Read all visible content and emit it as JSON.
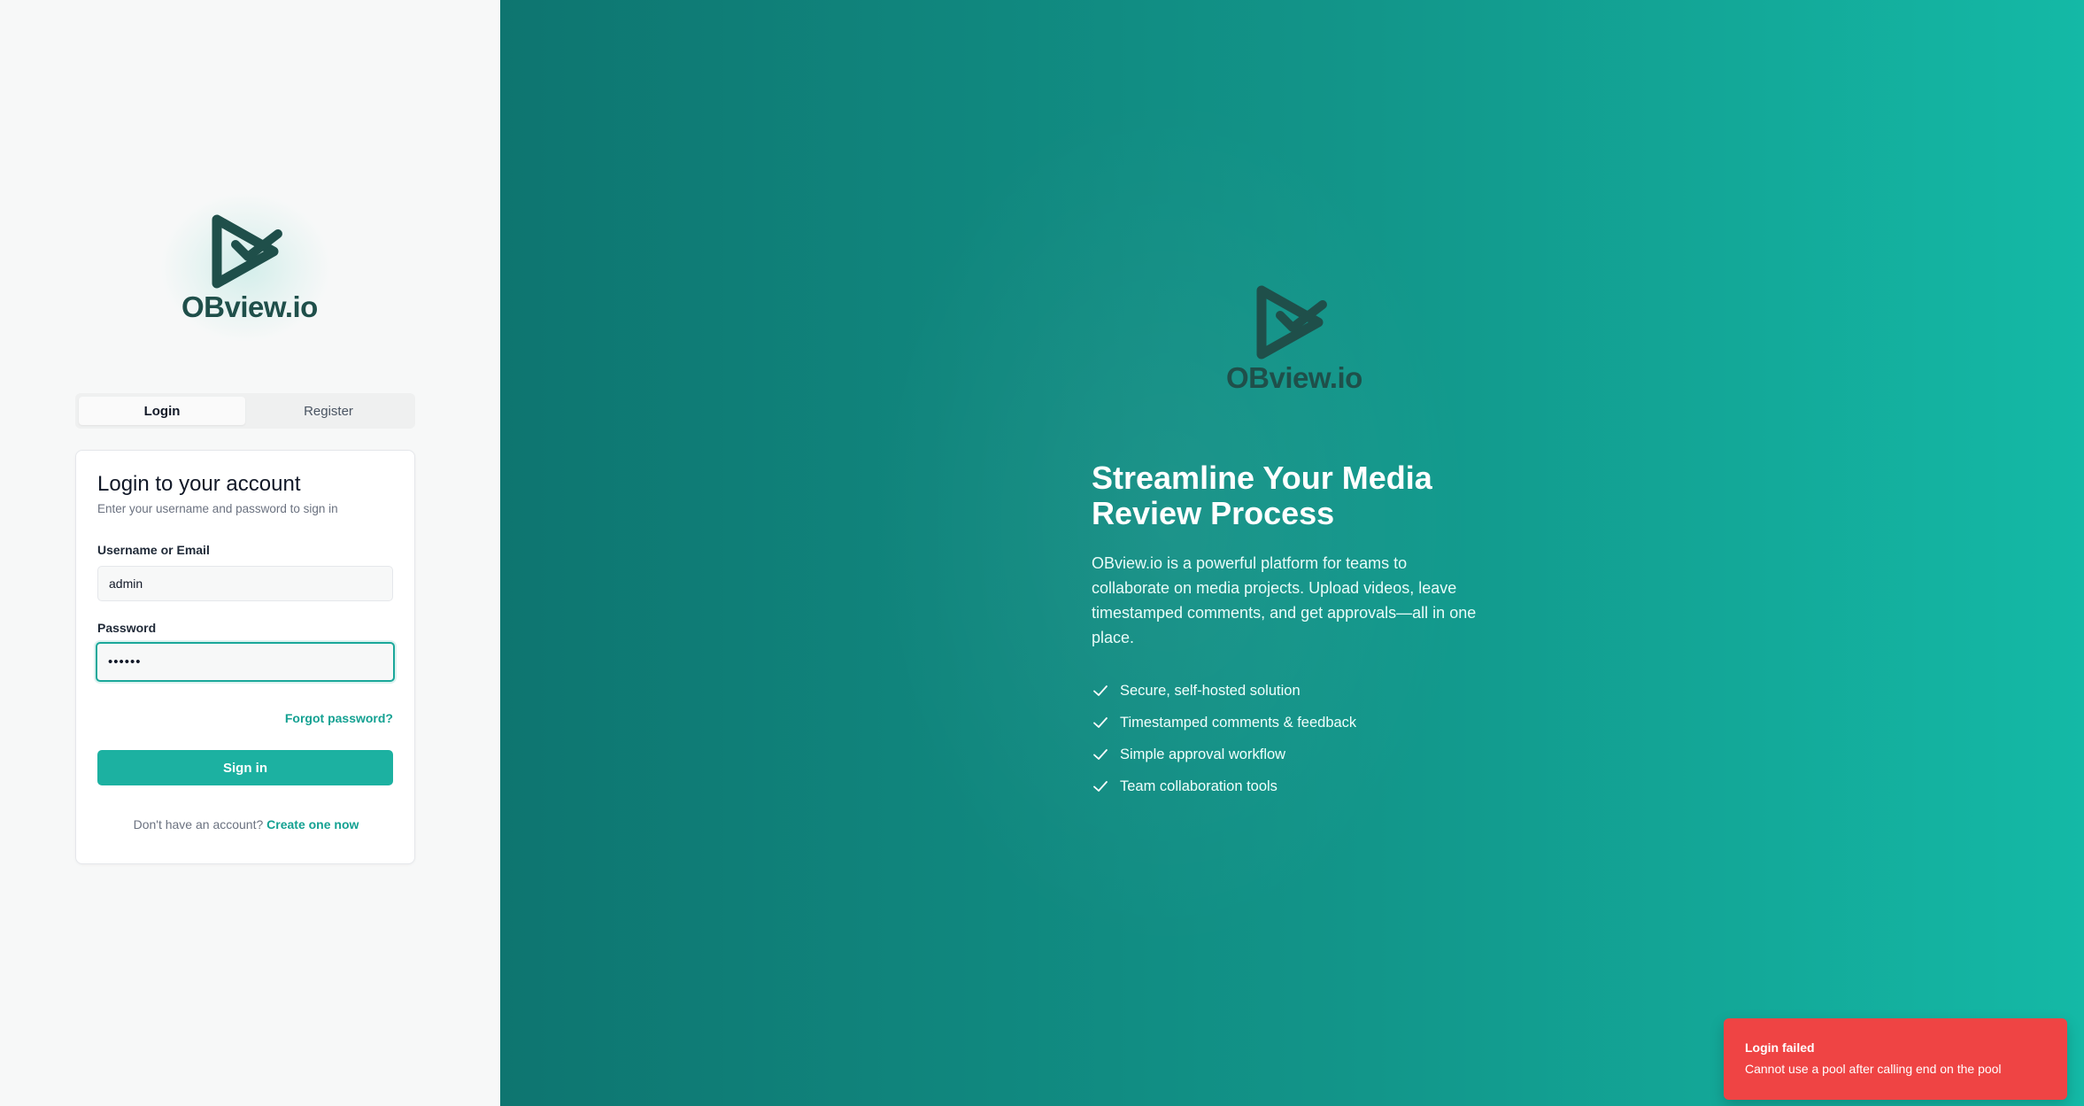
{
  "brand": {
    "name": "OBview.io",
    "logo_icon": "play-check-logo-icon",
    "colors": {
      "accent": "#1cb1a1",
      "logo": "#1f4f4a",
      "error": "#ef4444"
    }
  },
  "auth": {
    "tabs": [
      {
        "label": "Login",
        "active": true
      },
      {
        "label": "Register",
        "active": false
      }
    ],
    "card": {
      "title": "Login to your account",
      "subtitle": "Enter your username and password to sign in",
      "username_label": "Username or Email",
      "username_value": "admin",
      "password_label": "Password",
      "password_value": "••••••",
      "forgot_link": "Forgot password?",
      "submit_label": "Sign in",
      "no_account_text": "Don't have an account?",
      "create_link": "Create one now"
    }
  },
  "promo": {
    "headline": "Streamline Your Media Review Process",
    "description": "OBview.io is a powerful platform for teams to collaborate on media projects. Upload videos, leave timestamped comments, and get approvals—all in one place.",
    "features": [
      "Secure, self-hosted solution",
      "Timestamped comments & feedback",
      "Simple approval workflow",
      "Team collaboration tools"
    ],
    "feature_icon": "check-icon"
  },
  "toast": {
    "title": "Login failed",
    "message": "Cannot use a pool after calling end on the pool"
  }
}
